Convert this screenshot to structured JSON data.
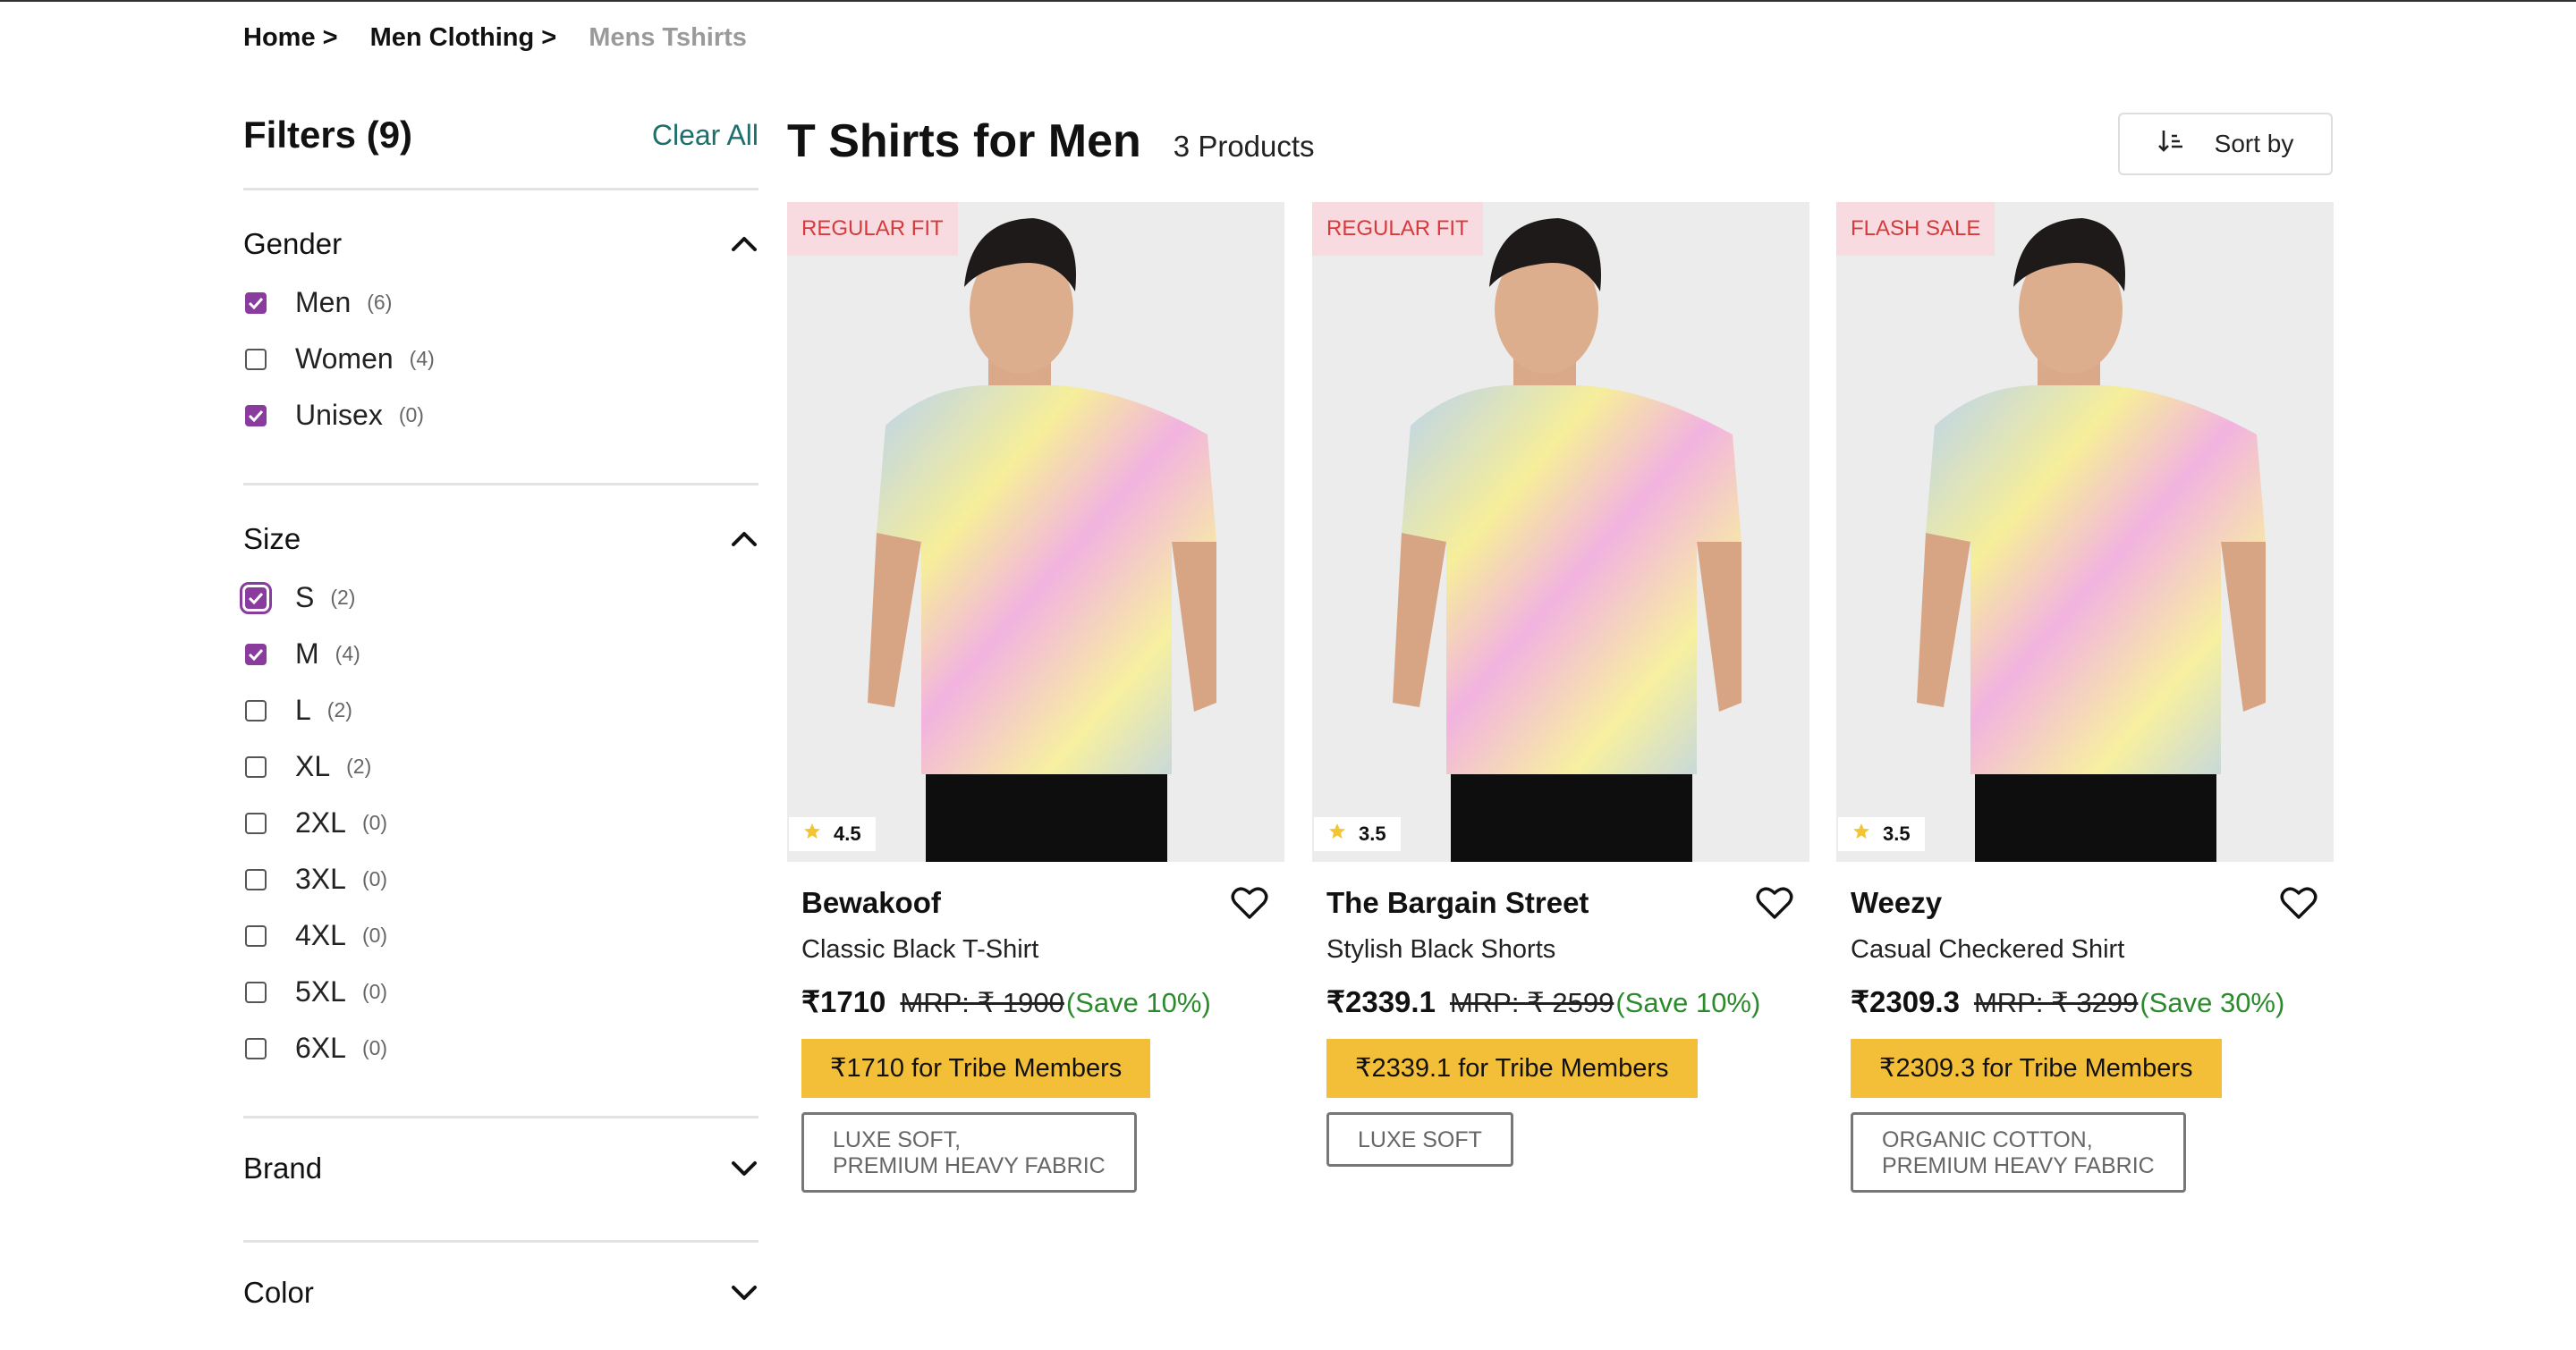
{
  "breadcrumb": [
    {
      "label": "Home >"
    },
    {
      "label": "Men Clothing >"
    },
    {
      "label": "Mens Tshirts"
    }
  ],
  "sidebar": {
    "title": "Filters (9)",
    "clear_all": "Clear All",
    "sections": {
      "gender": {
        "title": "Gender",
        "expanded": true,
        "options": [
          {
            "label": "Men",
            "count": "(6)",
            "checked": true
          },
          {
            "label": "Women",
            "count": "(4)",
            "checked": false
          },
          {
            "label": "Unisex",
            "count": "(0)",
            "checked": true
          }
        ]
      },
      "size": {
        "title": "Size",
        "expanded": true,
        "options": [
          {
            "label": "S",
            "count": "(2)",
            "checked": true,
            "focused": true
          },
          {
            "label": "M",
            "count": "(4)",
            "checked": true
          },
          {
            "label": "L",
            "count": "(2)",
            "checked": false
          },
          {
            "label": "XL",
            "count": "(2)",
            "checked": false
          },
          {
            "label": "2XL",
            "count": "(0)",
            "checked": false
          },
          {
            "label": "3XL",
            "count": "(0)",
            "checked": false
          },
          {
            "label": "4XL",
            "count": "(0)",
            "checked": false
          },
          {
            "label": "5XL",
            "count": "(0)",
            "checked": false
          },
          {
            "label": "6XL",
            "count": "(0)",
            "checked": false
          }
        ]
      },
      "brand": {
        "title": "Brand",
        "expanded": false
      },
      "color": {
        "title": "Color",
        "expanded": false
      }
    }
  },
  "main": {
    "title": "T Shirts for Men",
    "count": "3 Products",
    "sort_label": "Sort by"
  },
  "products": [
    {
      "tag": "REGULAR FIT",
      "rating": "4.5",
      "brand": "Bewakoof",
      "name": "Classic Black T-Shirt",
      "price": "₹1710",
      "mrp": "MRP: ₹ 1900 ",
      "save": "(Save 10%)",
      "tribe": "₹1710 for Tribe Members",
      "fabric": "LUXE SOFT,\nPREMIUM HEAVY FABRIC"
    },
    {
      "tag": "REGULAR FIT",
      "rating": "3.5",
      "brand": "The Bargain Street",
      "name": "Stylish Black Shorts",
      "price": "₹2339.1",
      "mrp": "MRP: ₹ 2599 ",
      "save": "(Save 10%)",
      "tribe": "₹2339.1 for Tribe Members",
      "fabric": "LUXE SOFT"
    },
    {
      "tag": "FLASH SALE",
      "rating": "3.5",
      "brand": "Weezy",
      "name": "Casual Checkered Shirt",
      "price": "₹2309.3",
      "mrp": "MRP: ₹ 3299 ",
      "save": "(Save 30%)",
      "tribe": "₹2309.3 for Tribe Members",
      "fabric": "ORGANIC COTTON,\nPREMIUM HEAVY FABRIC"
    }
  ],
  "colors": {
    "accent": "#8a3c9e",
    "tribe_bg": "#f3bf38",
    "save_green": "#2b8a2b",
    "clear_all": "#1c6f6a",
    "tag_bg": "#f7dbe0",
    "tag_text": "#d63b3b"
  }
}
